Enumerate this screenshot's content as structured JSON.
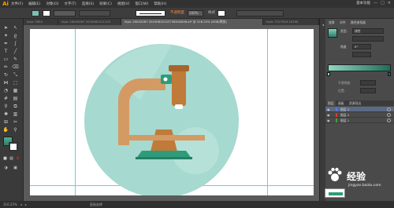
{
  "app": {
    "logo": "Ai"
  },
  "menu": [
    "文件(F)",
    "编辑(E)",
    "对象(O)",
    "文字(T)",
    "选择(S)",
    "效果(C)",
    "视图(V)",
    "窗口(W)",
    "帮助(H)"
  ],
  "workspace": {
    "label": "基本功能"
  },
  "options": {
    "mode_label": "不透明度",
    "opacity_value": "100%",
    "style_label": "样式"
  },
  "tabs": [
    {
      "label": "hlpic 2904",
      "active": false
    },
    {
      "label": "hlpic 29042067 2019082411103",
      "active": false
    },
    {
      "label": "hlpic 29042067 20190820103736016006.ai* @ 316.25% (RGB/预览)",
      "active": true
    },
    {
      "label": "hlpic 7227529 20190",
      "active": false
    }
  ],
  "panel": {
    "tabs": [
      "变换",
      "对齐",
      "路径查找器"
    ],
    "type_label": "类型:",
    "type_value": "线性",
    "angle_label": "角度",
    "angle_value": "0°",
    "opacity_label": "不透明度:",
    "position_label": "位置:",
    "layers_tabs": [
      "图层",
      "画板",
      "资源导出"
    ],
    "layers": [
      {
        "name": "图层 3",
        "color": "#4f7df3",
        "selected": true
      },
      {
        "name": "图层 2",
        "color": "#e0392b",
        "selected": false
      },
      {
        "name": "图层 1",
        "color": "#3da43d",
        "selected": false
      }
    ]
  },
  "status": {
    "zoom": "316.25%",
    "label": "直接选择"
  },
  "watermark": {
    "text": "经验",
    "url": "jingyan.baidu.com"
  },
  "colors": {
    "circle": "#a6d9cf",
    "arm": "#d49a64",
    "head": "#c07a3a",
    "base": "#2f9b7b"
  }
}
